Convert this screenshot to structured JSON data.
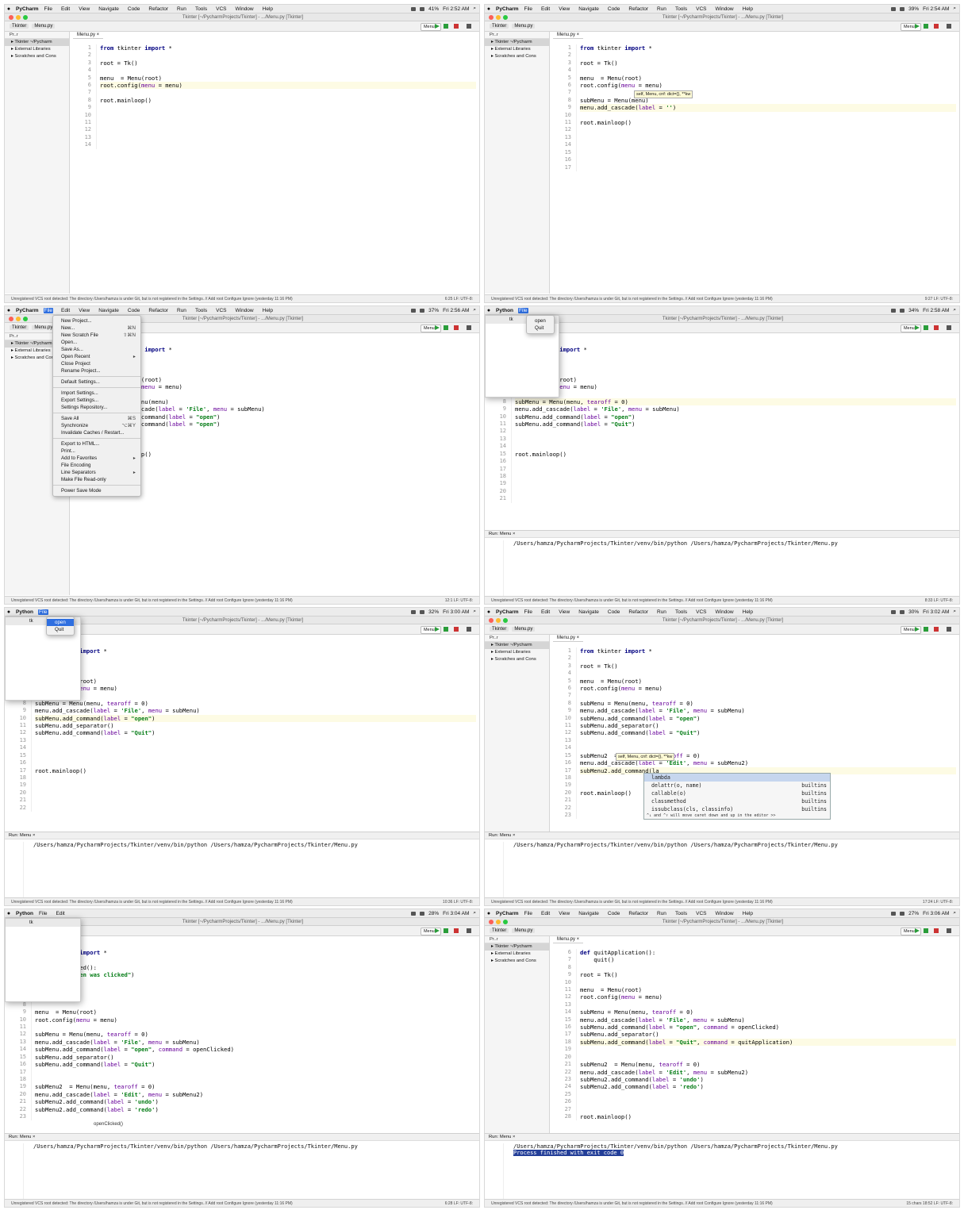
{
  "menubar": {
    "app": "PyCharm",
    "app_python": "Python",
    "items": [
      "File",
      "Edit",
      "View",
      "Navigate",
      "Code",
      "Refactor",
      "Run",
      "Tools",
      "VCS",
      "Window",
      "Help"
    ]
  },
  "window_title": "Tkinter [~/PycharmProjects/Tkinter] - .../Menu.py [Tkinter]",
  "window_title_short": "Tkinter [~/PycharmProjects/Tkinter]",
  "breadcrumb": {
    "project": "Tkinter",
    "file": "Menu.py"
  },
  "run_config": "Menu",
  "editor_tab": "Menu.py",
  "project_tree": {
    "toolbar": "Pr..r",
    "items": [
      "Tkinter ~/Pycharm",
      "External Libraries",
      "Scratches and Cons"
    ]
  },
  "run_panel": {
    "label": "Run:",
    "tab": "Menu",
    "command": "/Users/hamza/PycharmProjects/Tkinter/venv/bin/python /Users/hamza/PycharmProjects/Tkinter/Menu.py",
    "exit": "Process finished with exit code 0"
  },
  "status_text": "Unregistered VCS root detected: The directory /Users/hamza is under Git, but is not registered in the Settings. // Add root  Configure  Ignore (yesterday 11:16 PM)",
  "clocks": [
    "Fri 2:52 AM",
    "Fri 2:54 AM",
    "Fri 2:56 AM",
    "Fri 2:58 AM",
    "Fri 3:00 AM",
    "Fri 3:02 AM",
    "Fri 3:04 AM",
    "Fri 3:06 AM"
  ],
  "battery": [
    "41%",
    "39%",
    "37%",
    "34%",
    "32%",
    "30%",
    "28%",
    "27%"
  ],
  "positions": [
    "6:25",
    "9:27",
    "12:1",
    "8:33",
    "10:36",
    "17:24",
    "6:28",
    "18:52"
  ],
  "file_menu": [
    {
      "label": "New Project...",
      "shortcut": ""
    },
    {
      "label": "New...",
      "shortcut": "⌘N"
    },
    {
      "label": "New Scratch File",
      "shortcut": "⇧⌘N"
    },
    {
      "label": "Open...",
      "shortcut": ""
    },
    {
      "label": "Save As...",
      "shortcut": ""
    },
    {
      "label": "Open Recent",
      "shortcut": "▸"
    },
    {
      "label": "Close Project",
      "shortcut": ""
    },
    {
      "label": "Rename Project...",
      "shortcut": ""
    },
    {
      "label": "-"
    },
    {
      "label": "Default Settings...",
      "shortcut": ""
    },
    {
      "label": "-"
    },
    {
      "label": "Import Settings...",
      "shortcut": ""
    },
    {
      "label": "Export Settings...",
      "shortcut": ""
    },
    {
      "label": "Settings Repository...",
      "shortcut": ""
    },
    {
      "label": "-"
    },
    {
      "label": "Save All",
      "shortcut": "⌘S"
    },
    {
      "label": "Synchronize",
      "shortcut": "⌥⌘Y"
    },
    {
      "label": "Invalidate Caches / Restart...",
      "shortcut": ""
    },
    {
      "label": "-"
    },
    {
      "label": "Export to HTML...",
      "shortcut": ""
    },
    {
      "label": "Print...",
      "shortcut": ""
    },
    {
      "label": "Add to Favorites",
      "shortcut": "▸"
    },
    {
      "label": "File Encoding",
      "shortcut": ""
    },
    {
      "label": "Line Separators",
      "shortcut": "▸"
    },
    {
      "label": "Make File Read-only",
      "shortcut": ""
    },
    {
      "label": "-"
    },
    {
      "label": "Power Save Mode",
      "shortcut": ""
    }
  ],
  "tk_menu": [
    "open",
    "Quit"
  ],
  "tk_title": "tk",
  "tip": "self, Menu, cnf: dict={}, **kw",
  "autocomplete": {
    "items": [
      {
        "name": "lambda",
        "src": ""
      },
      {
        "name": "delattr(o, name)",
        "src": "builtins"
      },
      {
        "name": "callable(o)",
        "src": "builtins"
      },
      {
        "name": "classmethod",
        "src": "builtins"
      },
      {
        "name": "issubclass(cls, classinfo)",
        "src": "builtins"
      }
    ],
    "footer": "^↓ and ^↑ will move caret down and up in the editor  >>"
  },
  "breadcrumb_func": "openClicked()",
  "status_chars": "15 chars",
  "encoding": "LF: UTF-8:"
}
